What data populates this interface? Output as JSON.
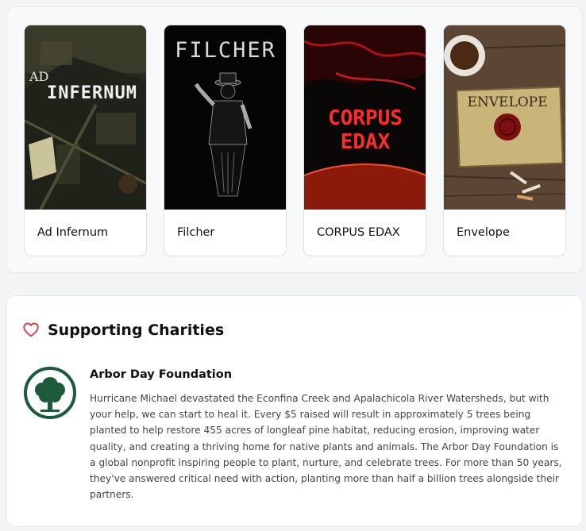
{
  "games": [
    {
      "title": "Ad Infernum",
      "art_text": [
        "AD",
        "INFERNUM"
      ]
    },
    {
      "title": "Filcher",
      "art_text": "FILCHER"
    },
    {
      "title": "CORPUS EDAX",
      "art_text": [
        "CORPUS",
        "EDAX"
      ]
    },
    {
      "title": "Envelope",
      "art_text": "ENVELOPE"
    }
  ],
  "charities": {
    "section_title": "Supporting Charities",
    "section_icon": "heart-icon",
    "items": [
      {
        "name": "Arbor Day Foundation",
        "logo_icon": "tree-icon",
        "description": "Hurricane Michael devastated the Econfina Creek and Apalachicola River Watersheds, but with your help, we can start to heal it. Every $5 raised will result in approximately 5 trees being planted to help restore 455 acres of longleaf pine habitat, reducing erosion, improving water quality, and creating a thriving home for native plants and animals. The Arbor Day Foundation is a global nonprofit inspiring people to plant, nurture, and celebrate trees. For more than 50 years, they've answered critical need with action, planting more than half a billion trees alongside their partners."
      }
    ]
  },
  "colors": {
    "heart": "#e0343d",
    "tree_logo": "#1d5a3c",
    "corpus_red": "#ff2a2a"
  }
}
